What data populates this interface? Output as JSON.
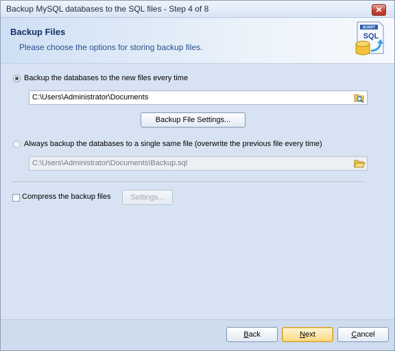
{
  "window": {
    "title": "Backup MySQL databases to the SQL files - Step 4 of 8"
  },
  "header": {
    "title": "Backup Files",
    "subtitle": "Please choose the options for storing backup files.",
    "icon_label": "SCRIPT",
    "icon_text": "SQL"
  },
  "options": {
    "new_files_label": "Backup the databases to the new files every time",
    "new_files_selected": true,
    "folder_path": "C:\\Users\\Administrator\\Documents",
    "file_settings_button": "Backup File Settings...",
    "single_file_label": "Always backup the databases to a single same file (overwrite the previous file every time)",
    "single_file_selected": false,
    "single_file_path": "C:\\Users\\Administrator\\Documents\\Backup.sql",
    "compress_label": "Compress the backup files",
    "compress_checked": false,
    "compress_settings_button": "Settings..."
  },
  "footer": {
    "back": {
      "accel": "B",
      "rest": "ack"
    },
    "next": {
      "accel": "N",
      "rest": "ext"
    },
    "cancel": {
      "accel": "C",
      "rest": "ancel"
    }
  }
}
